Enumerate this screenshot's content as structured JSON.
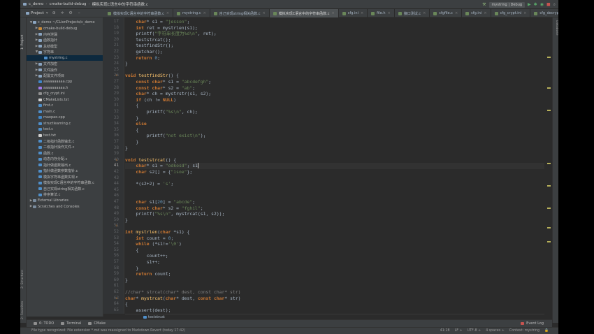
{
  "breadcrumb": [
    "c_demo",
    "cmake-build-debug",
    "模拟实现C语言中的字符串函数.c"
  ],
  "run_config": "mystring | Debug",
  "project_panel": {
    "title": "Project"
  },
  "tabs": [
    {
      "label": "模拟实现C语言中的字符串函数.c",
      "active": false
    },
    {
      "label": "mystring.c",
      "active": false
    },
    {
      "label": "自己实现string相关函数.c",
      "active": false
    },
    {
      "label": "模拟实现C语言中的字符串函数.c",
      "active": true
    },
    {
      "label": "cfg.ini",
      "active": false
    },
    {
      "label": "file.h",
      "active": false
    },
    {
      "label": "接口测试.c",
      "active": false
    },
    {
      "label": "cfgfile.c",
      "active": false
    },
    {
      "label": "cfg.ini",
      "active": false
    },
    {
      "label": "cfg_crypt.ini",
      "active": false
    },
    {
      "label": "cfg_decrypt.ini",
      "active": false
    }
  ],
  "left_vertical_tabs": [
    "1: Project",
    "2: Structure",
    "2: Favorites"
  ],
  "right_vertical_tabs": [
    "Database"
  ],
  "tree": [
    {
      "label": "c_demo  ~/CLionProjects/c_demo",
      "indent": 0,
      "arrow": "▼",
      "icon": "folder"
    },
    {
      "label": "cmake-build-debug",
      "indent": 1,
      "arrow": "▶",
      "icon": "folder orange"
    },
    {
      "label": "内存泄漏",
      "indent": 1,
      "arrow": "▶",
      "icon": "folder"
    },
    {
      "label": "函数指针",
      "indent": 1,
      "arrow": "▶",
      "icon": "folder"
    },
    {
      "label": "总结模型",
      "indent": 1,
      "arrow": "▶",
      "icon": "folder"
    },
    {
      "label": "字符串",
      "indent": 1,
      "arrow": "▼",
      "icon": "folder"
    },
    {
      "label": "mystring.c",
      "indent": 2,
      "arrow": "",
      "icon": "c",
      "selected": true
    },
    {
      "label": "文件加密",
      "indent": 1,
      "arrow": "▶",
      "icon": "folder"
    },
    {
      "label": "文件操作",
      "indent": 1,
      "arrow": "▶",
      "icon": "folder"
    },
    {
      "label": "配置文件项目",
      "indent": 1,
      "arrow": "▶",
      "icon": "folder"
    },
    {
      "label": "aaaaaaaaaa.cpp",
      "indent": 1,
      "arrow": "",
      "icon": "cpp"
    },
    {
      "label": "aaaaaaaaaa.h",
      "indent": 1,
      "arrow": "",
      "icon": "h"
    },
    {
      "label": "cfg_crypt.ini",
      "indent": 1,
      "arrow": "",
      "icon": "ini"
    },
    {
      "label": "CMakeLists.txt",
      "indent": 1,
      "arrow": "",
      "icon": "txt"
    },
    {
      "label": "first.c",
      "indent": 1,
      "arrow": "",
      "icon": "c"
    },
    {
      "label": "main.c",
      "indent": 1,
      "arrow": "",
      "icon": "c"
    },
    {
      "label": "maopao.cpp",
      "indent": 1,
      "arrow": "",
      "icon": "cpp"
    },
    {
      "label": "structlearning.c",
      "indent": 1,
      "arrow": "",
      "icon": "c"
    },
    {
      "label": "test.c",
      "indent": 1,
      "arrow": "",
      "icon": "c"
    },
    {
      "label": "test.txt",
      "indent": 1,
      "arrow": "",
      "icon": "txt"
    },
    {
      "label": "二级指针函数输出.c",
      "indent": 1,
      "arrow": "",
      "icon": "c"
    },
    {
      "label": "二级指针操作文件.c",
      "indent": 1,
      "arrow": "",
      "icon": "c"
    },
    {
      "label": "函数.c",
      "indent": 1,
      "arrow": "",
      "icon": "c"
    },
    {
      "label": "动态内存分配.c",
      "indent": 1,
      "arrow": "",
      "icon": "c"
    },
    {
      "label": "指针做函数输出.c",
      "indent": 1,
      "arrow": "",
      "icon": "c"
    },
    {
      "label": "指针做函数参数指针.c",
      "indent": 1,
      "arrow": "",
      "icon": "c"
    },
    {
      "label": "模拟字符串函数实现.c",
      "indent": 1,
      "arrow": "",
      "icon": "c"
    },
    {
      "label": "模拟实现C语言中的字符串函数.c",
      "indent": 1,
      "arrow": "",
      "icon": "c"
    },
    {
      "label": "自己实现string相关函数.c",
      "indent": 1,
      "arrow": "",
      "icon": "c"
    },
    {
      "label": "排序算法.c",
      "indent": 1,
      "arrow": "",
      "icon": "c"
    },
    {
      "label": "External Libraries",
      "indent": 0,
      "arrow": "▶",
      "icon": "lib"
    },
    {
      "label": "Scratches and Consoles",
      "indent": 0,
      "arrow": "▶",
      "icon": "lib"
    }
  ],
  "line_numbers": [
    17,
    18,
    19,
    20,
    21,
    22,
    23,
    24,
    25,
    26,
    27,
    28,
    29,
    30,
    31,
    32,
    33,
    34,
    35,
    36,
    37,
    38,
    39,
    40,
    41,
    42,
    43,
    44,
    45,
    46,
    47,
    48,
    49,
    50,
    51,
    52,
    53,
    54,
    55,
    56,
    57,
    58,
    59,
    60,
    61,
    62,
    63,
    64,
    65
  ],
  "function_markers": [
    26,
    40,
    51,
    63
  ],
  "current_line": 41,
  "code": [
    [
      [
        "    ",
        ""
      ],
      [
        "char",
        "kw"
      ],
      [
        "* s1 = ",
        ""
      ],
      [
        "\"jesson\"",
        "str"
      ],
      [
        ";",
        ""
      ]
    ],
    [
      [
        "    ",
        ""
      ],
      [
        "int",
        "kw"
      ],
      [
        " ret = mystrlen(s1);",
        ""
      ]
    ],
    [
      [
        "    printf(",
        ""
      ],
      [
        "\"字符串长度为%d\\n\"",
        "str"
      ],
      [
        ", ret);",
        ""
      ]
    ],
    [
      [
        "    teststrcat();",
        ""
      ]
    ],
    [
      [
        "    testfindStr();",
        ""
      ]
    ],
    [
      [
        "    getchar();",
        ""
      ]
    ],
    [
      [
        "    ",
        ""
      ],
      [
        "return",
        "kw"
      ],
      [
        " ",
        ""
      ],
      [
        "0",
        "num"
      ],
      [
        ";",
        ""
      ]
    ],
    [
      [
        "}",
        ""
      ]
    ],
    [
      [
        "",
        ""
      ]
    ],
    [
      [
        "",
        ""
      ],
      [
        "void",
        "kw"
      ],
      [
        " ",
        ""
      ],
      [
        "testfindStr",
        "fnname"
      ],
      [
        "() {",
        ""
      ]
    ],
    [
      [
        "    ",
        ""
      ],
      [
        "const char",
        "kw"
      ],
      [
        "* s1 = ",
        ""
      ],
      [
        "\"abcdefgh\"",
        "str"
      ],
      [
        ";",
        ""
      ]
    ],
    [
      [
        "    ",
        ""
      ],
      [
        "const char",
        "kw"
      ],
      [
        "* s2 = ",
        ""
      ],
      [
        "\"ab\"",
        "str"
      ],
      [
        ";",
        ""
      ]
    ],
    [
      [
        "    ",
        ""
      ],
      [
        "char",
        "kw"
      ],
      [
        "* ch = mystrstr(s1, s2);",
        ""
      ]
    ],
    [
      [
        "    ",
        ""
      ],
      [
        "if",
        "kw"
      ],
      [
        " (ch != ",
        ""
      ],
      [
        "NULL",
        "kw"
      ],
      [
        ")",
        ""
      ]
    ],
    [
      [
        "    {",
        ""
      ]
    ],
    [
      [
        "        printf(",
        ""
      ],
      [
        "\"%s\\n\"",
        "str"
      ],
      [
        ", ch);",
        ""
      ]
    ],
    [
      [
        "    }",
        ""
      ]
    ],
    [
      [
        "    ",
        ""
      ],
      [
        "else",
        "kw"
      ]
    ],
    [
      [
        "    {",
        ""
      ]
    ],
    [
      [
        "        printf(",
        ""
      ],
      [
        "\"not exist\\n\"",
        "str"
      ],
      [
        ");",
        ""
      ]
    ],
    [
      [
        "    }",
        ""
      ]
    ],
    [
      [
        "}",
        ""
      ]
    ],
    [
      [
        "",
        ""
      ]
    ],
    [
      [
        "",
        ""
      ],
      [
        "void",
        "kw"
      ],
      [
        " ",
        ""
      ],
      [
        "teststrcat",
        "fnname"
      ],
      [
        "() {",
        ""
      ]
    ],
    [
      [
        "    ",
        ""
      ],
      [
        "char",
        "kw"
      ],
      [
        "* s1 = ",
        ""
      ],
      [
        "\"odkosd\"",
        "str"
      ],
      [
        "; s1",
        ""
      ]
    ],
    [
      [
        "    ",
        ""
      ],
      [
        "char",
        "kw"
      ],
      [
        " s2[] = {",
        ""
      ],
      [
        "\"isoe\"",
        "str"
      ],
      [
        "};",
        ""
      ]
    ],
    [
      [
        "",
        ""
      ]
    ],
    [
      [
        "    *(s2+2) = ",
        ""
      ],
      [
        "'s'",
        "str"
      ],
      [
        ";",
        ""
      ]
    ],
    [
      [
        "",
        ""
      ]
    ],
    [
      [
        "",
        ""
      ]
    ],
    [
      [
        "    ",
        ""
      ],
      [
        "char",
        "kw"
      ],
      [
        " s1[",
        ""
      ],
      [
        "20",
        "num"
      ],
      [
        "] = ",
        ""
      ],
      [
        "\"abcde\"",
        "str"
      ],
      [
        ";",
        ""
      ]
    ],
    [
      [
        "    ",
        ""
      ],
      [
        "const char",
        "kw"
      ],
      [
        "* s2 = ",
        ""
      ],
      [
        "\"fghil\"",
        "str"
      ],
      [
        ";",
        ""
      ]
    ],
    [
      [
        "    printf(",
        ""
      ],
      [
        "\"%s\\n\"",
        "str"
      ],
      [
        ", mystrcat(s1, s2));",
        ""
      ]
    ],
    [
      [
        "}",
        ""
      ]
    ],
    [
      [
        "",
        ""
      ]
    ],
    [
      [
        "",
        ""
      ],
      [
        "int",
        "kw"
      ],
      [
        " ",
        ""
      ],
      [
        "mystrlen",
        "fnname"
      ],
      [
        "(",
        ""
      ],
      [
        "char",
        "kw"
      ],
      [
        " *s1) {",
        ""
      ]
    ],
    [
      [
        "    ",
        ""
      ],
      [
        "int",
        "kw"
      ],
      [
        " count = ",
        ""
      ],
      [
        "0",
        "num"
      ],
      [
        ";",
        ""
      ]
    ],
    [
      [
        "    ",
        ""
      ],
      [
        "while",
        "kw"
      ],
      [
        " (*s1!=",
        ""
      ],
      [
        "'\\0'",
        "str"
      ],
      [
        ")",
        ""
      ]
    ],
    [
      [
        "    {",
        ""
      ]
    ],
    [
      [
        "        count++;",
        ""
      ]
    ],
    [
      [
        "        s1++;",
        ""
      ]
    ],
    [
      [
        "    }",
        ""
      ]
    ],
    [
      [
        "    ",
        ""
      ],
      [
        "return",
        "kw"
      ],
      [
        " count;",
        ""
      ]
    ],
    [
      [
        "}",
        ""
      ]
    ],
    [
      [
        "",
        ""
      ]
    ],
    [
      [
        "",
        ""
      ],
      [
        "//char* strcat(char* dest, const char* str)",
        "com"
      ]
    ],
    [
      [
        "",
        ""
      ],
      [
        "char",
        "kw"
      ],
      [
        "* ",
        ""
      ],
      [
        "mystrcat",
        "fnname"
      ],
      [
        "(",
        ""
      ],
      [
        "char",
        "kw"
      ],
      [
        "* dest, ",
        ""
      ],
      [
        "const char",
        "kw"
      ],
      [
        "* str)",
        ""
      ]
    ],
    [
      [
        "{",
        ""
      ]
    ],
    [
      [
        "    assert(dest);",
        ""
      ]
    ]
  ],
  "editor_breadcrumb": "teststrcat",
  "bottom_tools": [
    "6: TODO",
    "Terminal",
    "CMake"
  ],
  "event_log": "Event Log",
  "status": {
    "message": "File type recognized: File extension *.md was reassigned to Markdown Revert (today 17:42)",
    "position": "41:28",
    "line_sep": "LF ÷",
    "encoding": "UTF-8 ÷",
    "indent": "4 spaces ÷",
    "context": "Context: mystring"
  }
}
